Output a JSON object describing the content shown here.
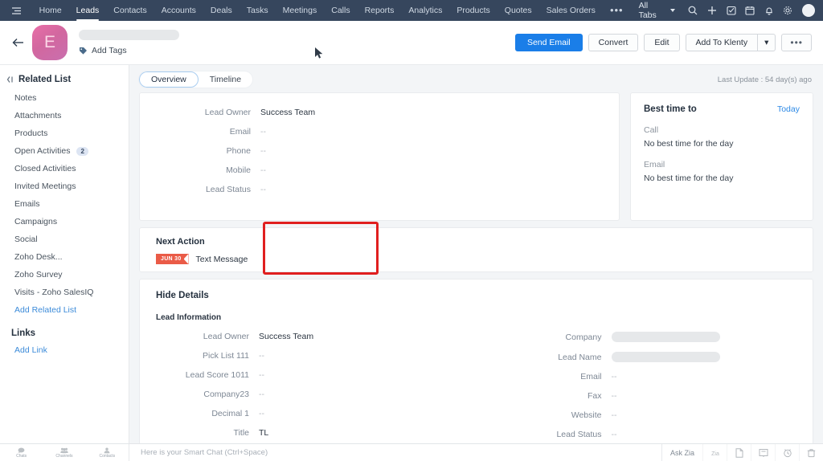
{
  "topnav": {
    "menu_icon": "hamburger-icon",
    "items": [
      {
        "label": "Home",
        "active": false
      },
      {
        "label": "Leads",
        "active": true
      },
      {
        "label": "Contacts",
        "active": false
      },
      {
        "label": "Accounts",
        "active": false
      },
      {
        "label": "Deals",
        "active": false
      },
      {
        "label": "Tasks",
        "active": false
      },
      {
        "label": "Meetings",
        "active": false
      },
      {
        "label": "Calls",
        "active": false
      },
      {
        "label": "Reports",
        "active": false
      },
      {
        "label": "Analytics",
        "active": false
      },
      {
        "label": "Products",
        "active": false
      },
      {
        "label": "Quotes",
        "active": false
      },
      {
        "label": "Sales Orders",
        "active": false
      }
    ],
    "more_label": "•••",
    "all_tabs_label": "All Tabs",
    "icons": [
      "search-icon",
      "plus-icon",
      "checkbox-task-icon",
      "calendar-icon",
      "bell-icon",
      "gear-icon",
      "user-avatar"
    ],
    "background_color": "#36465d"
  },
  "header": {
    "back_label": "←",
    "avatar_initial": "E",
    "avatar_color": "#d2679f",
    "record_title_redacted": true,
    "add_tags_label": "Add Tags",
    "buttons": {
      "send_email": "Send Email",
      "convert": "Convert",
      "edit": "Edit",
      "add_to_klenty": "Add To Klenty",
      "split_caret": "▾",
      "more": "•••"
    },
    "primary_color": "#1a7ee8"
  },
  "sidebar": {
    "title": "Related List",
    "items": [
      {
        "label": "Notes",
        "badge": ""
      },
      {
        "label": "Attachments",
        "badge": ""
      },
      {
        "label": "Products",
        "badge": ""
      },
      {
        "label": "Open Activities",
        "badge": "2"
      },
      {
        "label": "Closed Activities",
        "badge": ""
      },
      {
        "label": "Invited Meetings",
        "badge": ""
      },
      {
        "label": "Emails",
        "badge": ""
      },
      {
        "label": "Campaigns",
        "badge": ""
      },
      {
        "label": "Social",
        "badge": ""
      },
      {
        "label": "Zoho Desk...",
        "badge": ""
      },
      {
        "label": "Zoho Survey",
        "badge": ""
      },
      {
        "label": "Visits - Zoho SalesIQ",
        "badge": ""
      }
    ],
    "add_related_list": "Add Related List",
    "links_title": "Links",
    "add_link": "Add Link"
  },
  "main": {
    "tabs": [
      {
        "label": "Overview",
        "active": true
      },
      {
        "label": "Timeline",
        "active": false
      }
    ],
    "last_update": "Last Update : 54 day(s) ago",
    "summary_fields": [
      {
        "label": "Lead Owner",
        "value": "Success Team",
        "type": "text"
      },
      {
        "label": "Email",
        "value": "--",
        "type": "dash"
      },
      {
        "label": "Phone",
        "value": "--",
        "type": "dash"
      },
      {
        "label": "Mobile",
        "value": "--",
        "type": "dash"
      },
      {
        "label": "Lead Status",
        "value": "--",
        "type": "dash"
      }
    ],
    "best_time": {
      "title": "Best time to",
      "today_label": "Today",
      "rows": [
        {
          "label": "Call",
          "value": "No best time for the day"
        },
        {
          "label": "Email",
          "value": "No best time for the day"
        }
      ]
    },
    "next_action": {
      "title": "Next Action",
      "badge_date": "JUN 30",
      "badge_color": "#ea5b47",
      "action_label": "Text Message",
      "highlight_color": "#e01f1f"
    },
    "details": {
      "toggle_label": "Hide Details",
      "section_title": "Lead Information",
      "left_fields": [
        {
          "label": "Lead Owner",
          "value": "Success Team",
          "type": "text"
        },
        {
          "label": "Pick List 111",
          "value": "--",
          "type": "dash"
        },
        {
          "label": "Lead Score 1011",
          "value": "--",
          "type": "dash"
        },
        {
          "label": "Company23",
          "value": "--",
          "type": "dash"
        },
        {
          "label": "Decimal 1",
          "value": "--",
          "type": "dash"
        },
        {
          "label": "Title",
          "value": "TL",
          "type": "text"
        }
      ],
      "right_fields": [
        {
          "label": "Company",
          "value": "",
          "type": "redacted"
        },
        {
          "label": "Lead Name",
          "value": "",
          "type": "redacted"
        },
        {
          "label": "Email",
          "value": "--",
          "type": "dash"
        },
        {
          "label": "Fax",
          "value": "--",
          "type": "dash"
        },
        {
          "label": "Website",
          "value": "--",
          "type": "dash"
        },
        {
          "label": "Lead Status",
          "value": "--",
          "type": "dash"
        }
      ]
    }
  },
  "bottombar": {
    "tabs": [
      {
        "label": "Chats",
        "icon": "chat-icon"
      },
      {
        "label": "Channels",
        "icon": "channels-icon"
      },
      {
        "label": "Contacts",
        "icon": "contacts-icon"
      }
    ],
    "chat_placeholder": "Here is your Smart Chat (Ctrl+Space)",
    "ask_zia_label": "Ask Zia",
    "zia_label": "Zia",
    "icons": [
      "document-icon",
      "presentation-icon",
      "clock-icon",
      "trash-icon"
    ]
  }
}
